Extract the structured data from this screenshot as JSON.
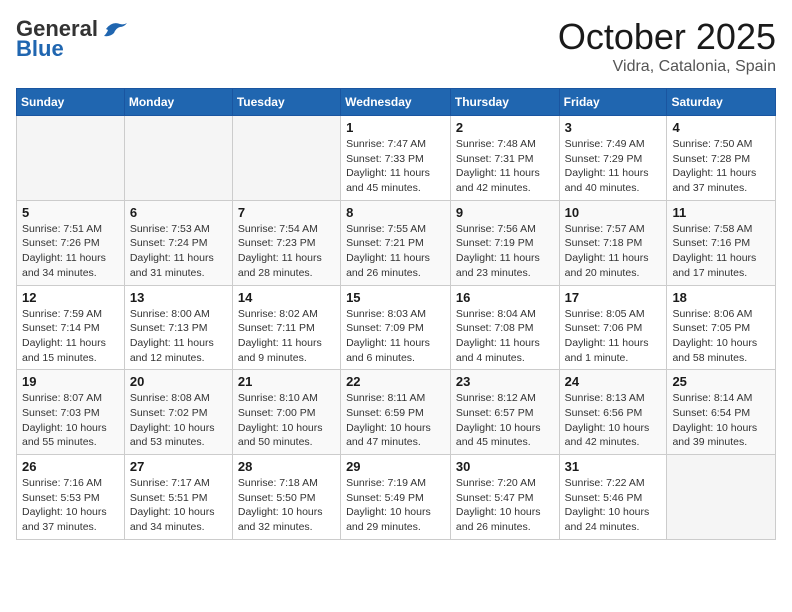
{
  "header": {
    "logo_general": "General",
    "logo_blue": "Blue",
    "title": "October 2025",
    "subtitle": "Vidra, Catalonia, Spain"
  },
  "weekdays": [
    "Sunday",
    "Monday",
    "Tuesday",
    "Wednesday",
    "Thursday",
    "Friday",
    "Saturday"
  ],
  "weeks": [
    [
      {
        "day": "",
        "info": ""
      },
      {
        "day": "",
        "info": ""
      },
      {
        "day": "",
        "info": ""
      },
      {
        "day": "1",
        "info": "Sunrise: 7:47 AM\nSunset: 7:33 PM\nDaylight: 11 hours and 45 minutes."
      },
      {
        "day": "2",
        "info": "Sunrise: 7:48 AM\nSunset: 7:31 PM\nDaylight: 11 hours and 42 minutes."
      },
      {
        "day": "3",
        "info": "Sunrise: 7:49 AM\nSunset: 7:29 PM\nDaylight: 11 hours and 40 minutes."
      },
      {
        "day": "4",
        "info": "Sunrise: 7:50 AM\nSunset: 7:28 PM\nDaylight: 11 hours and 37 minutes."
      }
    ],
    [
      {
        "day": "5",
        "info": "Sunrise: 7:51 AM\nSunset: 7:26 PM\nDaylight: 11 hours and 34 minutes."
      },
      {
        "day": "6",
        "info": "Sunrise: 7:53 AM\nSunset: 7:24 PM\nDaylight: 11 hours and 31 minutes."
      },
      {
        "day": "7",
        "info": "Sunrise: 7:54 AM\nSunset: 7:23 PM\nDaylight: 11 hours and 28 minutes."
      },
      {
        "day": "8",
        "info": "Sunrise: 7:55 AM\nSunset: 7:21 PM\nDaylight: 11 hours and 26 minutes."
      },
      {
        "day": "9",
        "info": "Sunrise: 7:56 AM\nSunset: 7:19 PM\nDaylight: 11 hours and 23 minutes."
      },
      {
        "day": "10",
        "info": "Sunrise: 7:57 AM\nSunset: 7:18 PM\nDaylight: 11 hours and 20 minutes."
      },
      {
        "day": "11",
        "info": "Sunrise: 7:58 AM\nSunset: 7:16 PM\nDaylight: 11 hours and 17 minutes."
      }
    ],
    [
      {
        "day": "12",
        "info": "Sunrise: 7:59 AM\nSunset: 7:14 PM\nDaylight: 11 hours and 15 minutes."
      },
      {
        "day": "13",
        "info": "Sunrise: 8:00 AM\nSunset: 7:13 PM\nDaylight: 11 hours and 12 minutes."
      },
      {
        "day": "14",
        "info": "Sunrise: 8:02 AM\nSunset: 7:11 PM\nDaylight: 11 hours and 9 minutes."
      },
      {
        "day": "15",
        "info": "Sunrise: 8:03 AM\nSunset: 7:09 PM\nDaylight: 11 hours and 6 minutes."
      },
      {
        "day": "16",
        "info": "Sunrise: 8:04 AM\nSunset: 7:08 PM\nDaylight: 11 hours and 4 minutes."
      },
      {
        "day": "17",
        "info": "Sunrise: 8:05 AM\nSunset: 7:06 PM\nDaylight: 11 hours and 1 minute."
      },
      {
        "day": "18",
        "info": "Sunrise: 8:06 AM\nSunset: 7:05 PM\nDaylight: 10 hours and 58 minutes."
      }
    ],
    [
      {
        "day": "19",
        "info": "Sunrise: 8:07 AM\nSunset: 7:03 PM\nDaylight: 10 hours and 55 minutes."
      },
      {
        "day": "20",
        "info": "Sunrise: 8:08 AM\nSunset: 7:02 PM\nDaylight: 10 hours and 53 minutes."
      },
      {
        "day": "21",
        "info": "Sunrise: 8:10 AM\nSunset: 7:00 PM\nDaylight: 10 hours and 50 minutes."
      },
      {
        "day": "22",
        "info": "Sunrise: 8:11 AM\nSunset: 6:59 PM\nDaylight: 10 hours and 47 minutes."
      },
      {
        "day": "23",
        "info": "Sunrise: 8:12 AM\nSunset: 6:57 PM\nDaylight: 10 hours and 45 minutes."
      },
      {
        "day": "24",
        "info": "Sunrise: 8:13 AM\nSunset: 6:56 PM\nDaylight: 10 hours and 42 minutes."
      },
      {
        "day": "25",
        "info": "Sunrise: 8:14 AM\nSunset: 6:54 PM\nDaylight: 10 hours and 39 minutes."
      }
    ],
    [
      {
        "day": "26",
        "info": "Sunrise: 7:16 AM\nSunset: 5:53 PM\nDaylight: 10 hours and 37 minutes."
      },
      {
        "day": "27",
        "info": "Sunrise: 7:17 AM\nSunset: 5:51 PM\nDaylight: 10 hours and 34 minutes."
      },
      {
        "day": "28",
        "info": "Sunrise: 7:18 AM\nSunset: 5:50 PM\nDaylight: 10 hours and 32 minutes."
      },
      {
        "day": "29",
        "info": "Sunrise: 7:19 AM\nSunset: 5:49 PM\nDaylight: 10 hours and 29 minutes."
      },
      {
        "day": "30",
        "info": "Sunrise: 7:20 AM\nSunset: 5:47 PM\nDaylight: 10 hours and 26 minutes."
      },
      {
        "day": "31",
        "info": "Sunrise: 7:22 AM\nSunset: 5:46 PM\nDaylight: 10 hours and 24 minutes."
      },
      {
        "day": "",
        "info": ""
      }
    ]
  ]
}
